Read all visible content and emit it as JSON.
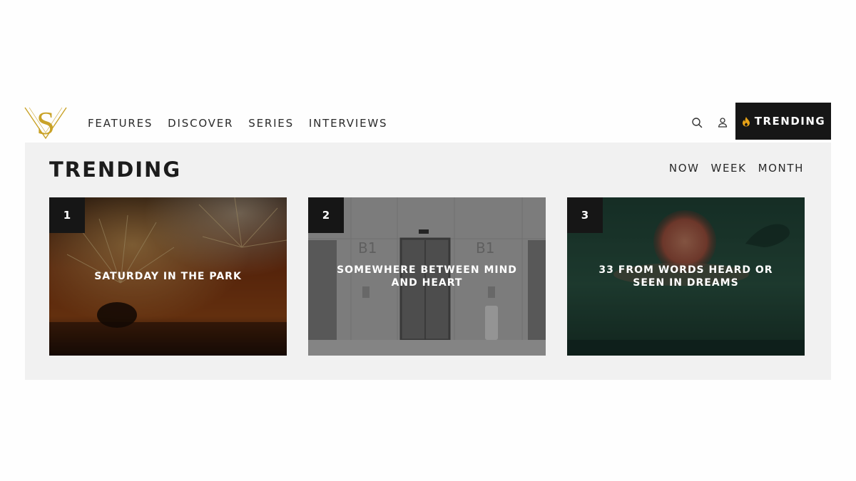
{
  "site": {
    "logo_text": "SV",
    "logo_icon": "sv-monogram-logo",
    "brand_gold": "#c9a227"
  },
  "nav": {
    "items": [
      {
        "label": "FEATURES"
      },
      {
        "label": "DISCOVER"
      },
      {
        "label": "SERIES"
      },
      {
        "label": "INTERVIEWS"
      }
    ]
  },
  "header_actions": {
    "search_icon": "search-icon",
    "user_icon": "user-icon",
    "trending_label": "TRENDING",
    "trending_icon": "flame-icon",
    "flame_color": "#e8a317"
  },
  "trending": {
    "title": "TRENDING",
    "ranges": [
      {
        "label": "NOW"
      },
      {
        "label": "WEEK"
      },
      {
        "label": "MONTH"
      }
    ],
    "cards": [
      {
        "rank": "1",
        "title": "SATURDAY IN THE PARK"
      },
      {
        "rank": "2",
        "title": "SOMEWHERE BETWEEN MIND AND HEART"
      },
      {
        "rank": "3",
        "title": "33 FROM WORDS HEARD OR SEEN IN DREAMS"
      }
    ]
  }
}
